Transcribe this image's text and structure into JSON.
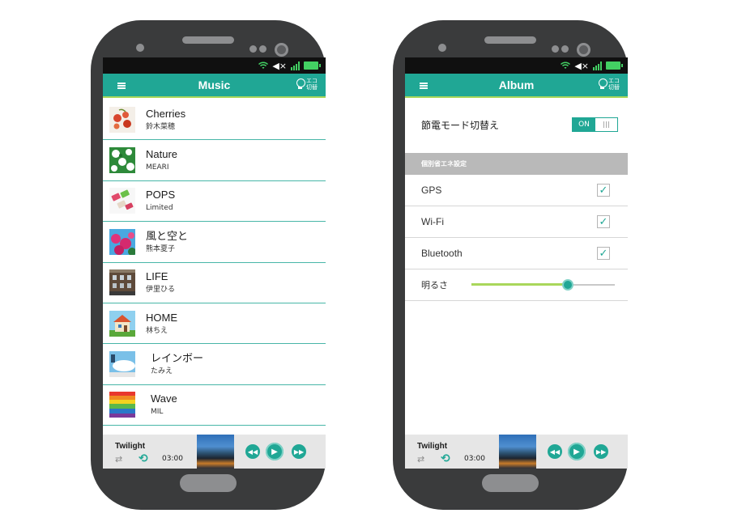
{
  "left_screen": {
    "app_title": "Music",
    "eco_label": "エコ切替",
    "songs": [
      {
        "title": "Cherries",
        "artist": "鈴木菜穂",
        "thumb": "cherries"
      },
      {
        "title": "Nature",
        "artist": "MEARI",
        "thumb": "nature"
      },
      {
        "title": "POPS",
        "artist": "Limited",
        "thumb": "pops"
      },
      {
        "title": "風と空と",
        "artist": "熊本夏子",
        "thumb": "flowers"
      },
      {
        "title": "LIFE",
        "artist": "伊里ひる",
        "thumb": "building"
      },
      {
        "title": "HOME",
        "artist": "林ちえ",
        "thumb": "house"
      },
      {
        "title": "レインボー",
        "artist": "たみえ",
        "thumb": "sky"
      },
      {
        "title": "Wave",
        "artist": "MIL",
        "thumb": "rainbow"
      }
    ],
    "player": {
      "track": "Twilight",
      "time": "03:00"
    }
  },
  "right_screen": {
    "app_title": "Album",
    "eco_label": "エコ切替",
    "eco_mode": {
      "label": "節電モード切替え",
      "toggle": "ON"
    },
    "section_header": "個別省エネ設定",
    "settings": [
      {
        "label": "GPS",
        "checked": true
      },
      {
        "label": "Wi-Fi",
        "checked": true
      },
      {
        "label": "Bluetooth",
        "checked": true
      }
    ],
    "brightness": {
      "label": "明るさ",
      "level": 0.67
    },
    "player": {
      "track": "Twilight",
      "time": "03:00"
    }
  },
  "colors": {
    "teal": "#20a795",
    "lime": "#a9d75b",
    "phone_body": "#3a3b3c",
    "status_green": "#43d063"
  },
  "icons": {
    "menu": "hamburger-menu-icon",
    "eco": "bulb-icon",
    "shuffle": "shuffle-icon",
    "repeat": "repeat-icon",
    "prev": "rewind-icon",
    "play": "play-icon",
    "next": "fast-forward-icon",
    "check": "checkmark-icon"
  }
}
